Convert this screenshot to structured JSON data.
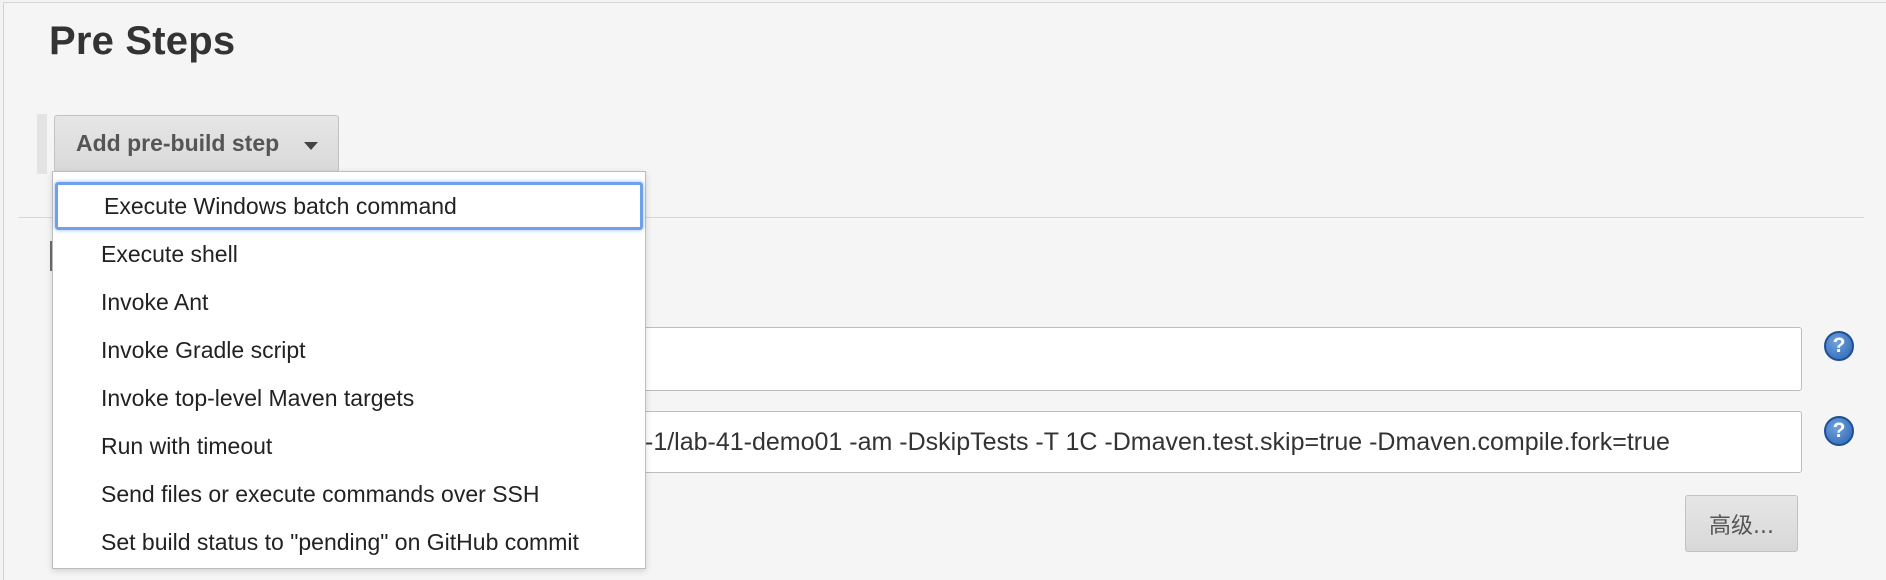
{
  "section": {
    "title": "Pre Steps"
  },
  "add_step_button": {
    "label": "Add pre-build step"
  },
  "dropdown": {
    "items": [
      {
        "label": "Execute Windows batch command",
        "focused": true
      },
      {
        "label": "Execute shell"
      },
      {
        "label": "Invoke Ant"
      },
      {
        "label": "Invoke Gradle script"
      },
      {
        "label": "Invoke top-level Maven targets"
      },
      {
        "label": "Run with timeout"
      },
      {
        "label": "Send files or execute commands over SSH"
      },
      {
        "label": "Set build status to \"pending\" on GitHub commit"
      }
    ]
  },
  "fields": {
    "field1_value": "",
    "field2_value": "-1/lab-41-demo01 -am -DskipTests -T 1C -Dmaven.test.skip=true  -Dmaven.compile.fork=true"
  },
  "help": {
    "glyph": "?"
  },
  "advanced_button": {
    "label": "高级..."
  }
}
